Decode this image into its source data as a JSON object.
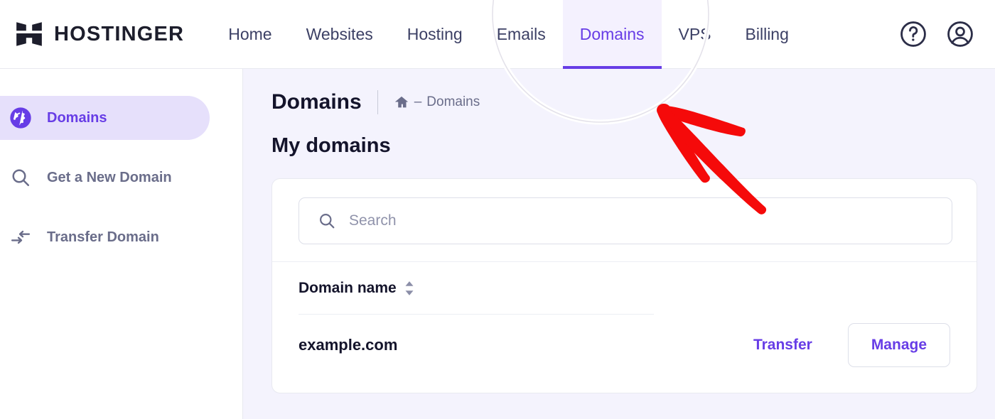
{
  "brand": {
    "name": "HOSTINGER",
    "logo_icon": "hostinger-h-logo"
  },
  "topnav": {
    "items": [
      {
        "label": "Home",
        "active": false
      },
      {
        "label": "Websites",
        "active": false
      },
      {
        "label": "Hosting",
        "active": false
      },
      {
        "label": "Emails",
        "active": false
      },
      {
        "label": "Domains",
        "active": true
      },
      {
        "label": "VPS",
        "active": false
      },
      {
        "label": "Billing",
        "active": false
      }
    ],
    "help_icon": "question-mark-circle-icon",
    "account_icon": "user-account-circle-icon",
    "active_color": "#673de6",
    "active_bg": "#f4f1fe"
  },
  "sidebar": {
    "items": [
      {
        "label": "Domains",
        "icon": "globe-icon",
        "active": true
      },
      {
        "label": "Get a New Domain",
        "icon": "search-icon",
        "active": false
      },
      {
        "label": "Transfer Domain",
        "icon": "transfer-arrows-icon",
        "active": false
      }
    ],
    "active_bg": "#e6e0fb",
    "active_color": "#673de6"
  },
  "breadcrumb": {
    "title": "Domains",
    "home_icon": "home-icon",
    "separator": "–",
    "current": "Domains"
  },
  "page": {
    "title": "My domains"
  },
  "search": {
    "placeholder": "Search",
    "value": "",
    "icon": "search-icon"
  },
  "table": {
    "columns": [
      {
        "label": "Domain name",
        "sort_icon": "sort-updown-icon"
      }
    ],
    "rows": [
      {
        "domain": "example.com",
        "transfer_label": "Transfer",
        "manage_label": "Manage"
      }
    ]
  },
  "annotation": {
    "highlight_shape": "circle-spotlight",
    "arrow": "red-hand-drawn-arrow",
    "arrow_color": "#f50a0a",
    "target": "Domains"
  }
}
